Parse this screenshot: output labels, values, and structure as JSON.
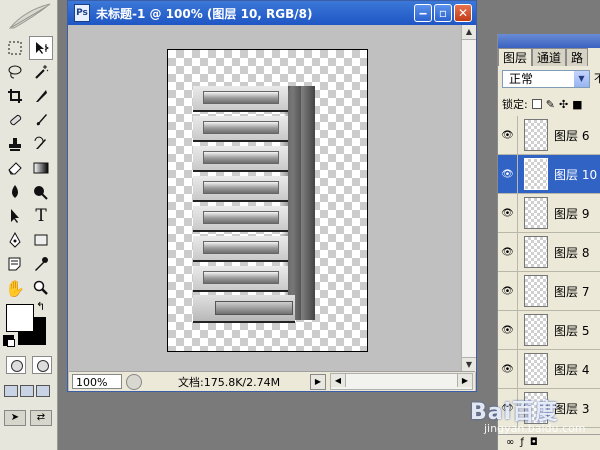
{
  "document": {
    "title": "未标题-1 @ 100% (图层 10, RGB/8)",
    "zoom": "100%",
    "doc_info": "文档:175.8K/2.74M"
  },
  "layers_panel": {
    "tabs": [
      "图层",
      "通道",
      "路"
    ],
    "blend_mode": "正常",
    "blend_extra": "不",
    "lock_label": "锁定:",
    "layers": [
      {
        "name": "图层 6",
        "selected": false
      },
      {
        "name": "图层 10",
        "selected": true
      },
      {
        "name": "图层 9",
        "selected": false
      },
      {
        "name": "图层 8",
        "selected": false
      },
      {
        "name": "图层 7",
        "selected": false
      },
      {
        "name": "图层 5",
        "selected": false
      },
      {
        "name": "图层 4",
        "selected": false
      },
      {
        "name": "图层 3",
        "selected": false
      }
    ]
  },
  "colors": {
    "foreground": "#ffffff",
    "background": "#000000",
    "titlebar": "#1f56c4",
    "selection": "#3163c5"
  },
  "toolbox": {
    "tools": [
      "marquee-icon",
      "move-icon",
      "lasso-icon",
      "magic-wand-icon",
      "crop-icon",
      "slice-icon",
      "healing-icon",
      "brush-icon",
      "stamp-icon",
      "history-brush-icon",
      "eraser-icon",
      "gradient-icon",
      "blur-icon",
      "dodge-icon",
      "path-select-icon",
      "type-icon",
      "pen-icon",
      "shape-icon",
      "notes-icon",
      "eyedropper-icon",
      "hand-icon",
      "zoom-icon"
    ]
  },
  "watermark": {
    "main": "Bai百度",
    "sub": "jingyan.baidu.com"
  }
}
